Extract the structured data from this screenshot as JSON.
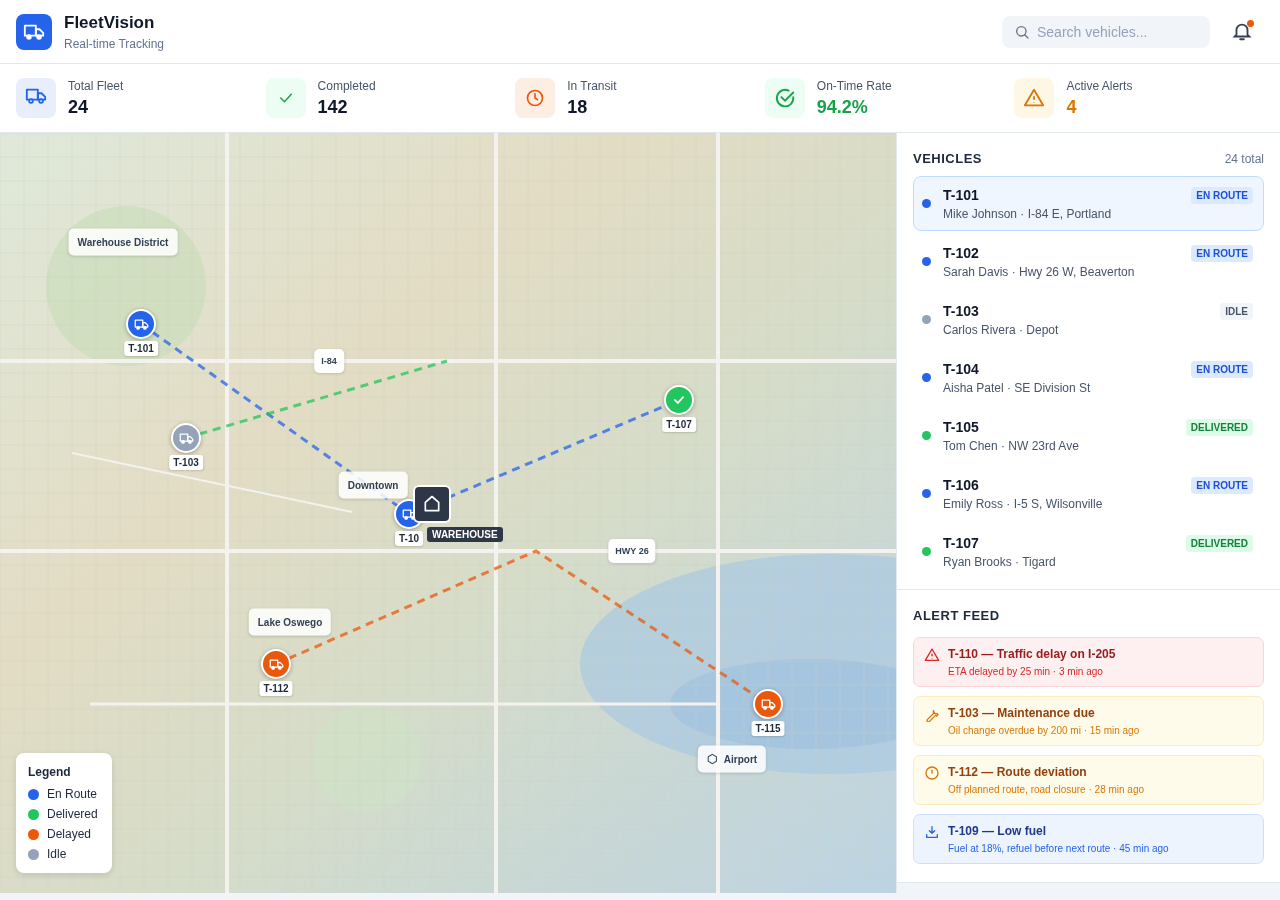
{
  "header": {
    "title": "FleetVision",
    "subtitle": "Real-time Tracking",
    "search": {
      "placeholder": "Search vehicles..."
    },
    "notifications": {
      "unread": true
    }
  },
  "stats": [
    {
      "kind": "fleet",
      "label": "Total Fleet",
      "value": "24"
    },
    {
      "kind": "completed",
      "label": "Completed",
      "value": "142"
    },
    {
      "kind": "transit",
      "label": "In Transit",
      "value": "18"
    },
    {
      "kind": "ontime",
      "label": "On-Time Rate",
      "value": "94.2%"
    },
    {
      "kind": "alerts",
      "label": "Active Alerts",
      "value": "4"
    }
  ],
  "map": {
    "places": [
      {
        "kind": "area",
        "name": "Warehouse District"
      },
      {
        "kind": "road",
        "name": "I-84"
      },
      {
        "kind": "area",
        "name": "Downtown"
      },
      {
        "kind": "road",
        "name": "HWY 26"
      },
      {
        "kind": "area",
        "name": "Lake Oswego"
      },
      {
        "kind": "airport",
        "name": "Airport"
      }
    ],
    "markers": [
      {
        "label": "T-101",
        "color": "#2563eb",
        "kind": "truck"
      },
      {
        "label": "T-103",
        "color": "#94a3b8",
        "kind": "truck"
      },
      {
        "label": "T-107",
        "color": "#22c55e",
        "kind": "check"
      },
      {
        "label": "T-10",
        "color": "#2563eb",
        "kind": "truck"
      },
      {
        "label": "T-112",
        "color": "#ea580c",
        "kind": "truck"
      },
      {
        "label": "T-115",
        "color": "#ea580c",
        "kind": "truck"
      }
    ],
    "depot": {
      "label": "WAREHOUSE"
    },
    "legend": {
      "title": "Legend",
      "items": [
        {
          "color": "#2563eb",
          "label": "En Route"
        },
        {
          "color": "#22c55e",
          "label": "Delivered"
        },
        {
          "color": "#ea580c",
          "label": "Delayed"
        },
        {
          "color": "#94a3b8",
          "label": "Idle"
        }
      ]
    }
  },
  "vehicles": {
    "title": "VEHICLES",
    "count": "24 total",
    "items": [
      {
        "id": "T-101",
        "detail": "Mike Johnson · I-84 E, Portland",
        "color": "#2563eb",
        "badge": "EN ROUTE",
        "selected": true
      },
      {
        "id": "T-102",
        "detail": "Sarah Davis · Hwy 26 W, Beaverton",
        "color": "#2563eb",
        "badge": "EN ROUTE",
        "selected": false
      },
      {
        "id": "T-103",
        "detail": "Carlos Rivera · Depot",
        "color": "#94a3b8",
        "badge": "IDLE",
        "selected": false
      },
      {
        "id": "T-104",
        "detail": "Aisha Patel · SE Division St",
        "color": "#2563eb",
        "badge": "EN ROUTE",
        "selected": false
      },
      {
        "id": "T-105",
        "detail": "Tom Chen · NW 23rd Ave",
        "color": "#22c55e",
        "badge": "DELIVERED",
        "selected": false
      },
      {
        "id": "T-106",
        "detail": "Emily Ross · I-5 S, Wilsonville",
        "color": "#2563eb",
        "badge": "EN ROUTE",
        "selected": false
      },
      {
        "id": "T-107",
        "detail": "Ryan Brooks · Tigard",
        "color": "#22c55e",
        "badge": "DELIVERED",
        "selected": false
      }
    ]
  },
  "alerts": {
    "title": "ALERT FEED",
    "items": [
      {
        "kind": "danger",
        "title": "T-110 — Traffic delay on I-205",
        "detail": "ETA delayed by 25 min · 3 min ago"
      },
      {
        "kind": "maintenance",
        "title": "T-103 — Maintenance due",
        "detail": "Oil change overdue by 200 mi · 15 min ago"
      },
      {
        "kind": "deviation",
        "title": "T-112 — Route deviation",
        "detail": "Off planned route, road closure · 28 min ago"
      },
      {
        "kind": "info",
        "title": "T-109 — Low fuel",
        "detail": "Fuel at 18%, refuel before next route · 45 min ago"
      }
    ]
  }
}
